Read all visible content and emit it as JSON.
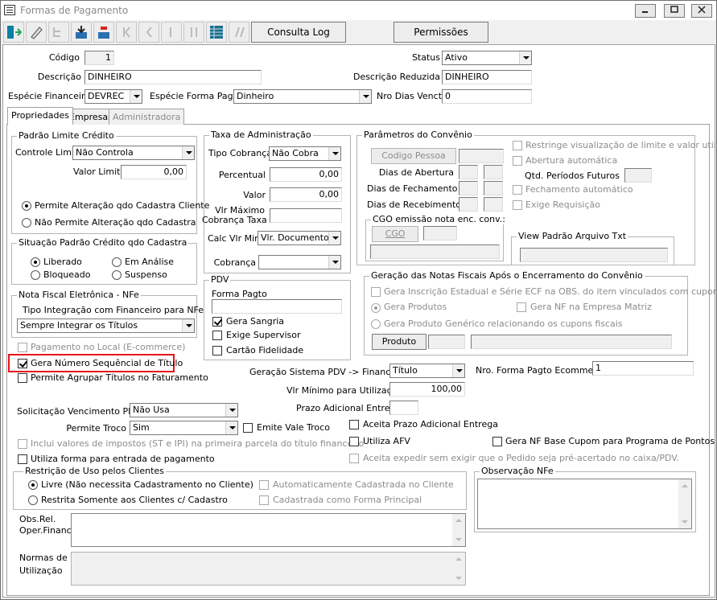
{
  "window": {
    "title": "Formas de Pagamento",
    "minimize": "0",
    "maximize": "1",
    "close": "r"
  },
  "toolbar": {
    "icons": [
      "exit-icon",
      "edit-icon",
      "tree-icon",
      "save-icon",
      "delete-icon",
      "nav-first-icon",
      "nav-prev-icon",
      "nav-next-icon",
      "nav-last-icon",
      "grid-icon",
      "refresh-icon"
    ],
    "consulta_log": "Consulta Log",
    "permissoes": "Permissões"
  },
  "header": {
    "codigo_label": "Código",
    "codigo_value": "1",
    "status_label": "Status",
    "status_value": "Ativo",
    "descricao_label": "Descrição",
    "descricao_value": "DINHEIRO",
    "descricao_reduzida_label": "Descrição Reduzida",
    "descricao_reduzida_value": "DINHEIRO",
    "especie_financeira_label": "Espécie Financeira",
    "especie_financeira_value": "DEVREC",
    "especie_forma_pagto_label": "Espécie Forma Pagto",
    "especie_forma_pagto_value": "Dinheiro",
    "nro_dias_vencto_label": "Nro Dias Vencto",
    "nro_dias_vencto_value": "0"
  },
  "tabs": [
    "Propriedades",
    "Empresas",
    "Administradora"
  ],
  "padrao_limite": {
    "caption": "Padrão Limite Crédito",
    "controle_limite_label": "Controle Limite",
    "controle_limite_value": "Não Controla",
    "valor_limite_label": "Valor Limite",
    "valor_limite_value": "0,00",
    "radio1": "Permite Alteração qdo Cadastra Cliente",
    "radio2": "Não Permite Alteração qdo Cadastra"
  },
  "situacao": {
    "caption": "Situação Padrão Crédito qdo Cadastra",
    "liberado": "Liberado",
    "em_analise": "Em Análise",
    "bloqueado": "Bloqueado",
    "suspenso": "Suspenso"
  },
  "nfe": {
    "caption": "Nota Fiscal Eletrônica - NFe",
    "tipo_label": "Tipo Integração com Financeiro para NFe",
    "tipo_value": "Sempre Integrar os Títulos"
  },
  "taxa": {
    "caption": "Taxa de Administração",
    "tipo_cobranca_label": "Tipo Cobrança",
    "tipo_cobranca_value": "Não Cobra",
    "percentual_label": "Percentual",
    "percentual_value": "0,00",
    "valor_label": "Valor",
    "valor_value": "0,00",
    "vlr_max_label1": "Vlr Máximo",
    "vlr_max_label2": "Cobrança Taxa",
    "calc_label": "Calc Vlr Min",
    "calc_value": "Vlr. Documento",
    "cobranca_label": "Cobrança"
  },
  "pdv": {
    "caption": "PDV",
    "forma_pagto_label": "Forma Pagto",
    "gera_sangria": "Gera Sangria",
    "exige_supervisor": "Exige Supervisor",
    "cartao_fidelidade": "Cartão Fidelidade"
  },
  "convenio": {
    "caption": "Parâmetros do Convênio",
    "codigo_pessoa": "Codigo Pessoa",
    "dias_abertura": "Dias de Abertura",
    "dias_fechamento": "Dias de Fechamento",
    "dias_recebimento": "Dias de Recebimento",
    "restringe": "Restringe visualização de limite e valor util.",
    "abertura_auto": "Abertura automática",
    "qtd_periodos": "Qtd. Períodos Futuros",
    "fechamento_auto": "Fechamento automático",
    "exige_requisicao": "Exige Requisição",
    "cgo_caption": "CGO emissão nota enc. conv.:",
    "cgo_btn": "CGO",
    "view_caption": "View Padrão Arquivo Txt"
  },
  "geracao_nf": {
    "caption": "Geração das Notas Fiscais Após o Encerramento do Convênio",
    "gera_ie": "Gera Inscrição Estadual e Série ECF na OBS. do item vinculados com cupons",
    "gera_produtos": "Gera Produtos",
    "gera_nf_matriz": "Gera NF na Empresa Matriz",
    "gera_generico": "Gera Produto Genérico relacionando os cupons fiscais",
    "produto_btn": "Produto"
  },
  "options": {
    "pagamento_local": "Pagamento no Local (E-commerce)",
    "gera_numero": "Gera Número Sequêncial de Título",
    "permite_agrupar": "Permite Agrupar Títulos no Faturamento",
    "geracao_pdv_label": "Geração Sistema PDV -> Financeiro",
    "geracao_pdv_value": "Título",
    "nro_forma_ecommerce_label": "Nro. Forma Pagto Ecommerce",
    "nro_forma_ecommerce_value": "1",
    "vlr_minimo_label": "Vlr Mínimo para Utilização",
    "vlr_minimo_value": "100,00",
    "prazo_label": "Prazo Adicional Entrega",
    "solicitacao_label": "Solicitação Vencimento PDV",
    "solicitacao_value": "Não Usa",
    "aceita_prazo": "Aceita Prazo Adicional Entrega",
    "permite_troco_label": "Permite Troco",
    "permite_troco_value": "Sim",
    "emite_vale": "Emite Vale Troco",
    "inclui_valores": "Inclui valores de impostos (ST e IPI) na primeira parcela do título financeiro",
    "utiliza_afv": "Utiliza AFV",
    "gera_nf_cupom": "Gera NF Base Cupom para Programa de Pontos",
    "utiliza_forma": "Utiliza forma para entrada de pagamento",
    "aceita_expedir": "Aceita expedir sem exigir que o Pedido seja pré-acertado no caixa/PDV."
  },
  "restricao": {
    "caption": "Restrição de Uso pelos Clientes",
    "livre": "Livre (Não necessita Cadastramento no Cliente)",
    "restrita": "Restrita Somente aos Clientes c/ Cadastro",
    "auto_cadastrada": "Automaticamente Cadastrada no Cliente",
    "cadastrada_principal": "Cadastrada como Forma Principal"
  },
  "observacao": {
    "caption": "Observação NFe"
  },
  "obs_rel": {
    "label1": "Obs.Rel.",
    "label2": "Oper.Financ."
  },
  "normas": {
    "label1": "Normas de",
    "label2": "Utilização"
  },
  "colors": {
    "highlight": "#e8141b"
  }
}
